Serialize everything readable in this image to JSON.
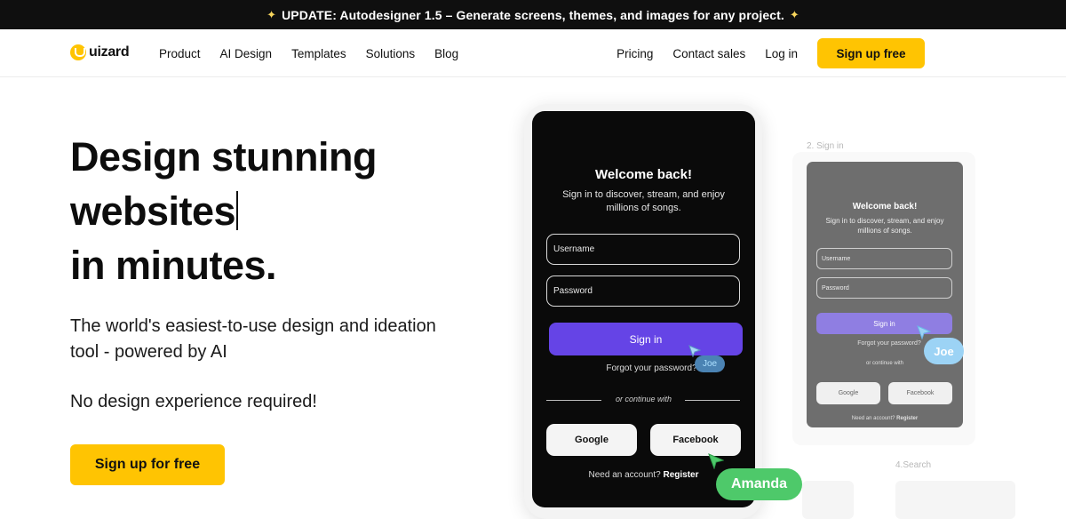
{
  "banner": {
    "text": "UPDATE: Autodesigner 1.5 – Generate screens, themes, and images for any project."
  },
  "nav": {
    "logo_text": "uizard",
    "links": [
      "Product",
      "AI Design",
      "Templates",
      "Solutions",
      "Blog"
    ],
    "right_links": [
      "Pricing",
      "Contact sales",
      "Log in"
    ],
    "cta": "Sign up free"
  },
  "hero": {
    "headline": [
      "Design stunning",
      "websites",
      "in minutes."
    ],
    "subtitle": "The world's easiest-to-use design and ideation tool - powered by AI",
    "note": "No design experience required!",
    "cta": "Sign up for free"
  },
  "mockup": {
    "title": "Welcome back!",
    "subtitle": "Sign in to discover, stream, and enjoy millions of songs.",
    "username_placeholder": "Username",
    "password_placeholder": "Password",
    "signin_button": "Sign in",
    "forgot": "Forgot your password?",
    "or": "or continue with",
    "google": "Google",
    "facebook": "Facebook",
    "need_account": "Need an account?",
    "register": "Register"
  },
  "back_mockup": {
    "step_label": "2. Sign in",
    "next_step_label": "4.Search",
    "or": "or continue with"
  },
  "collaborators": {
    "joe": "Joe",
    "amanda": "Amanda"
  },
  "colors": {
    "accent": "#ffc402",
    "signin": "#6544e6",
    "amanda": "#4ec96a",
    "joe": "#9cd3f5"
  }
}
